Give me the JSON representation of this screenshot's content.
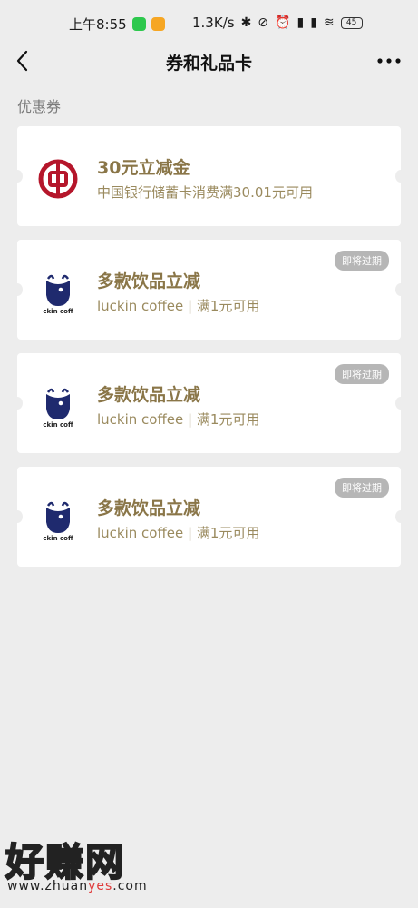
{
  "status_bar": {
    "time": "上午8:55",
    "net_speed": "1.3K/s",
    "battery": "45"
  },
  "nav": {
    "title": "券和礼品卡"
  },
  "section": {
    "label": "优惠券"
  },
  "coupons": [
    {
      "title": "30元立减金",
      "subtitle": "中国银行储蓄卡消费满30.01元可用",
      "badge": "",
      "logo": "bank-of-china-logo-icon"
    },
    {
      "title": "多款饮品立减",
      "subtitle": "luckin coffee | 满1元可用",
      "badge": "即将过期",
      "logo": "luckin-coffee-logo-icon",
      "logo_text": "ckin coff"
    },
    {
      "title": "多款饮品立减",
      "subtitle": "luckin coffee | 满1元可用",
      "badge": "即将过期",
      "logo": "luckin-coffee-logo-icon",
      "logo_text": "ckin coff"
    },
    {
      "title": "多款饮品立减",
      "subtitle": "luckin coffee | 满1元可用",
      "badge": "即将过期",
      "logo": "luckin-coffee-logo-icon",
      "logo_text": "ckin coff"
    }
  ],
  "watermark": {
    "big": "好赚网",
    "small_pre": "www.zhuan",
    "small_yes": "yes",
    "small_post": ".com"
  },
  "colors": {
    "background": "#ededed",
    "card": "#ffffff",
    "title_gold": "#8a7648",
    "subtitle_gold": "#9a8a5e",
    "badge_gray": "#b6b6b6",
    "boc_red": "#b5162b",
    "luckin_navy": "#1f2a6e"
  }
}
